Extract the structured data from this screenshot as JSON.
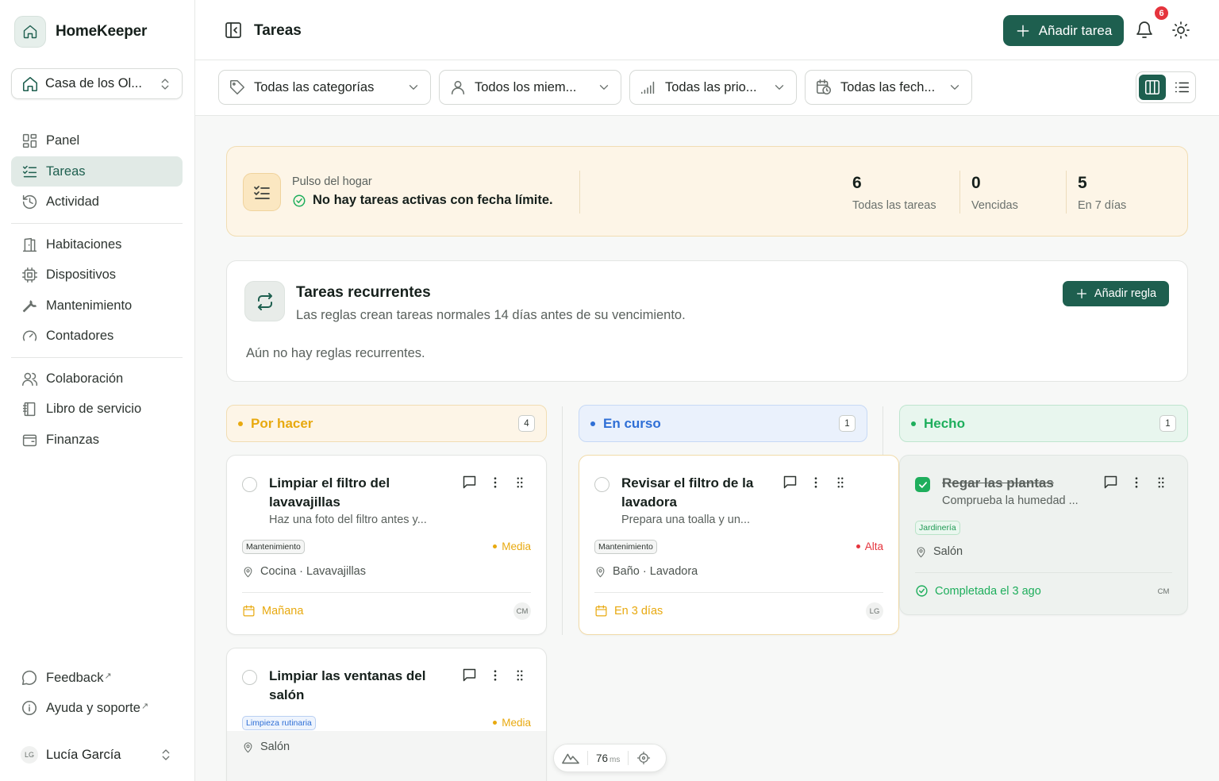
{
  "app": {
    "name": "HomeKeeper",
    "house": "Casa de los Ol..."
  },
  "nav": {
    "primary": [
      {
        "label": "Panel",
        "icon": "grid-icon"
      },
      {
        "label": "Tareas",
        "icon": "checklist-icon",
        "active": true
      },
      {
        "label": "Actividad",
        "icon": "history-icon"
      }
    ],
    "secondary": [
      {
        "label": "Habitaciones",
        "icon": "door-icon"
      },
      {
        "label": "Dispositivos",
        "icon": "chip-icon"
      },
      {
        "label": "Mantenimiento",
        "icon": "wrench-icon"
      },
      {
        "label": "Contadores",
        "icon": "gauge-icon"
      }
    ],
    "tertiary": [
      {
        "label": "Colaboración",
        "icon": "users-icon"
      },
      {
        "label": "Libro de servicio",
        "icon": "book-icon"
      },
      {
        "label": "Finanzas",
        "icon": "wallet-icon"
      }
    ],
    "footer": [
      {
        "label": "Feedback",
        "icon": "chat-icon"
      },
      {
        "label": "Ayuda y soporte",
        "icon": "info-icon"
      }
    ],
    "external_mark": "↗"
  },
  "user": {
    "initials": "LG",
    "name": "Lucía García"
  },
  "header": {
    "title": "Tareas",
    "add_task": "Añadir tarea",
    "notifications": "6"
  },
  "filters": {
    "categories": "Todas las categorías",
    "members": "Todos los miem...",
    "priorities": "Todas las prio...",
    "dates": "Todas las fech..."
  },
  "pulse": {
    "label": "Pulso del hogar",
    "message": "No hay tareas activas con fecha límite.",
    "stats": [
      {
        "value": "6",
        "label": "Todas las tareas"
      },
      {
        "value": "0",
        "label": "Vencidas"
      },
      {
        "value": "5",
        "label": "En 7 días"
      }
    ]
  },
  "recurring": {
    "title": "Tareas recurrentes",
    "description": "Las reglas crean tareas normales 14 días antes de su vencimiento.",
    "empty": "Aún no hay reglas recurrentes.",
    "add_rule": "Añadir regla"
  },
  "columns": [
    {
      "label": "Por hacer",
      "count": "4",
      "color": "#e8a90f"
    },
    {
      "label": "En curso",
      "count": "1",
      "color": "#2f6fd6"
    },
    {
      "label": "Hecho",
      "count": "1",
      "color": "#1eae5c"
    }
  ],
  "cards": {
    "t1": {
      "title": "Limpiar el filtro del lavavajillas",
      "desc": "Haz una foto del filtro antes y...",
      "tag": "Mantenimiento",
      "priority": "Media",
      "location": "Cocina · Lavavajillas",
      "due": "Mañana",
      "initials": "CM"
    },
    "t2": {
      "title": "Limpiar las ventanas del salón",
      "tag": "Limpieza rutinaria",
      "priority": "Media",
      "location": "Salón"
    },
    "t3": {
      "title": "Revisar el filtro de la lavadora",
      "desc": "Prepara una toalla y un...",
      "tag": "Mantenimiento",
      "priority": "Alta",
      "location": "Baño · Lavadora",
      "due": "En 3 días",
      "initials": "LG"
    },
    "t4": {
      "title": "Regar las plantas",
      "desc": "Comprueba la humedad ...",
      "tag": "Jardinería",
      "location": "Salón",
      "completed": "Completada el 3 ago",
      "initials": "CM"
    }
  },
  "colors": {
    "brand": "#1e5f4f",
    "medium": "#e8a90f",
    "high": "#e5343d",
    "done": "#1eae5c"
  },
  "devtools": {
    "ms": "76",
    "unit": "ms"
  }
}
